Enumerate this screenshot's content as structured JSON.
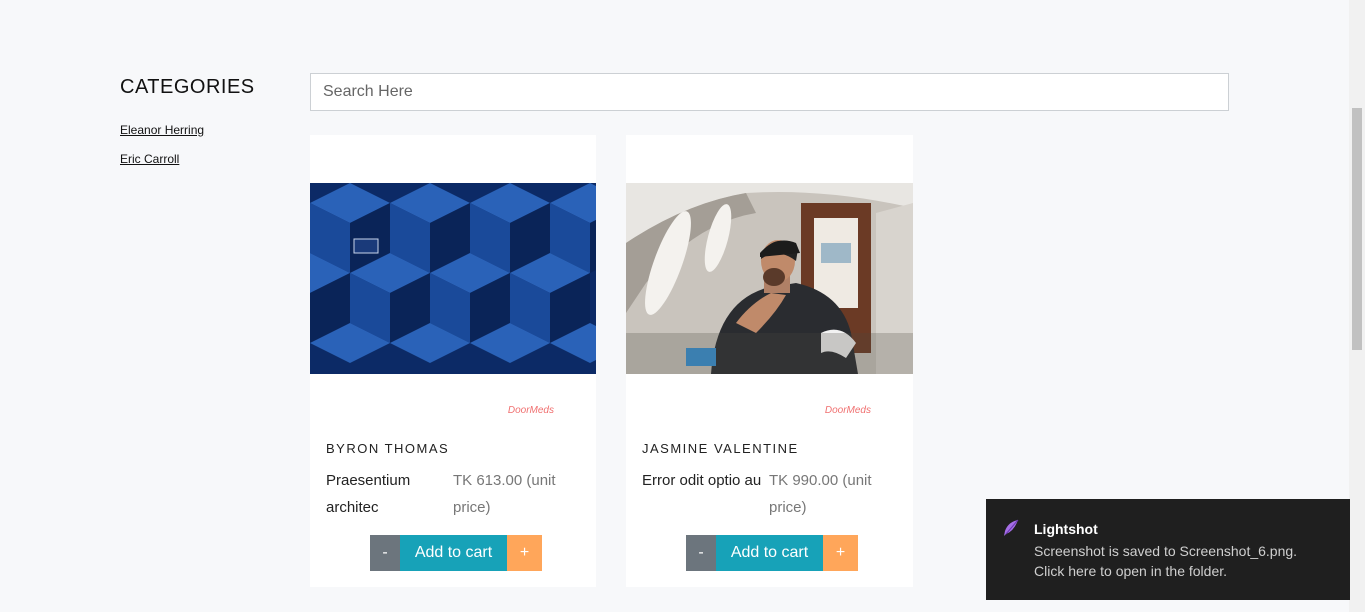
{
  "sidebar": {
    "title": "CATEGORIES",
    "links": [
      "Eleanor Herring",
      "Eric Carroll"
    ]
  },
  "search": {
    "placeholder": "Search Here"
  },
  "products": [
    {
      "brand": "DoorMeds",
      "vendor": "BYRON THOMAS",
      "name": "Praesentium architec",
      "price": "TK 613.00 (unit price)",
      "minus_label": "-",
      "add_label": "Add to cart",
      "plus_label": "+"
    },
    {
      "brand": "DoorMeds",
      "vendor": "JASMINE VALENTINE",
      "name": "Error odit optio au",
      "price": "TK 990.00 (unit price)",
      "minus_label": "-",
      "add_label": "Add to cart",
      "plus_label": "+"
    }
  ],
  "notification": {
    "app": "Lightshot",
    "message_line1": "Screenshot is saved to Screenshot_6.png.",
    "message_line2": "Click here to open in the folder."
  },
  "colors": {
    "page_bg": "#f7f8fa",
    "minus_button": "#6c757d",
    "add_button": "#17a2b8",
    "plus_button": "#ffa65a",
    "brand_text": "#f07070",
    "toast_bg": "#1f1f1f"
  }
}
